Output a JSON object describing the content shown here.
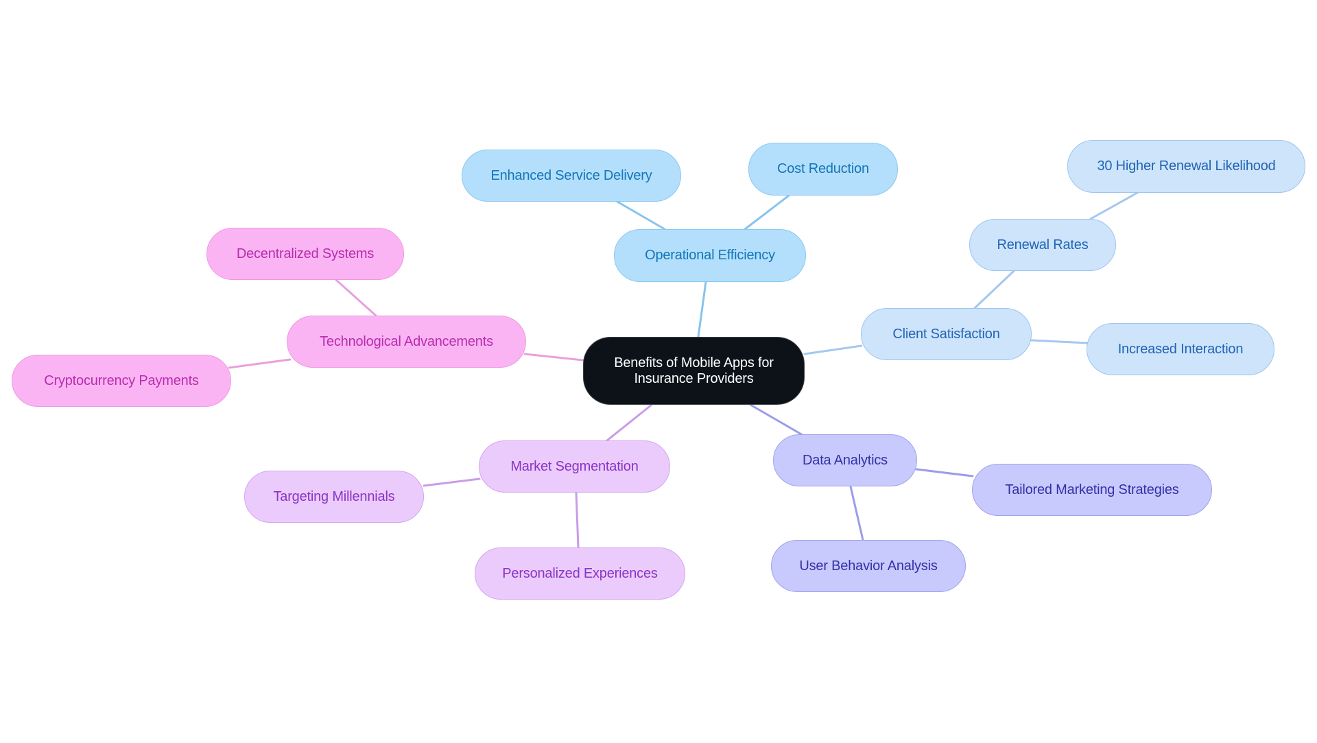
{
  "diagram": {
    "type": "mindmap",
    "root": {
      "label": "Benefits of Mobile Apps for Insurance Providers",
      "line1": "Benefits of Mobile Apps for",
      "line2": "Insurance Providers"
    },
    "colors": {
      "root_fill": "#0c1218",
      "operational": {
        "fill": "#b3dffc",
        "text": "#1475b8",
        "edge": "#88c4ec"
      },
      "client": {
        "fill": "#cde4fb",
        "text": "#2264b4",
        "edge": "#a4c8ef"
      },
      "data": {
        "fill": "#c8c9fc",
        "text": "#3232a8",
        "edge": "#9c9cea"
      },
      "market": {
        "fill": "#ebcbfc",
        "text": "#8a34c4",
        "edge": "#c99ce9"
      },
      "tech": {
        "fill": "#fbb4f3",
        "text": "#b82cb0",
        "edge": "#e8a0de"
      }
    },
    "branches": [
      {
        "label": "Operational Efficiency",
        "children": [
          {
            "label": "Enhanced Service Delivery"
          },
          {
            "label": "Cost Reduction"
          }
        ]
      },
      {
        "label": "Client Satisfaction",
        "children": [
          {
            "label": "Renewal Rates",
            "children": [
              {
                "label": "30 Higher Renewal Likelihood"
              }
            ]
          },
          {
            "label": "Increased Interaction"
          }
        ]
      },
      {
        "label": "Data Analytics",
        "children": [
          {
            "label": "Tailored Marketing Strategies"
          },
          {
            "label": "User Behavior Analysis"
          }
        ]
      },
      {
        "label": "Market Segmentation",
        "children": [
          {
            "label": "Targeting Millennials"
          },
          {
            "label": "Personalized Experiences"
          }
        ]
      },
      {
        "label": "Technological Advancements",
        "children": [
          {
            "label": "Decentralized Systems"
          },
          {
            "label": "Cryptocurrency Payments"
          }
        ]
      }
    ]
  }
}
